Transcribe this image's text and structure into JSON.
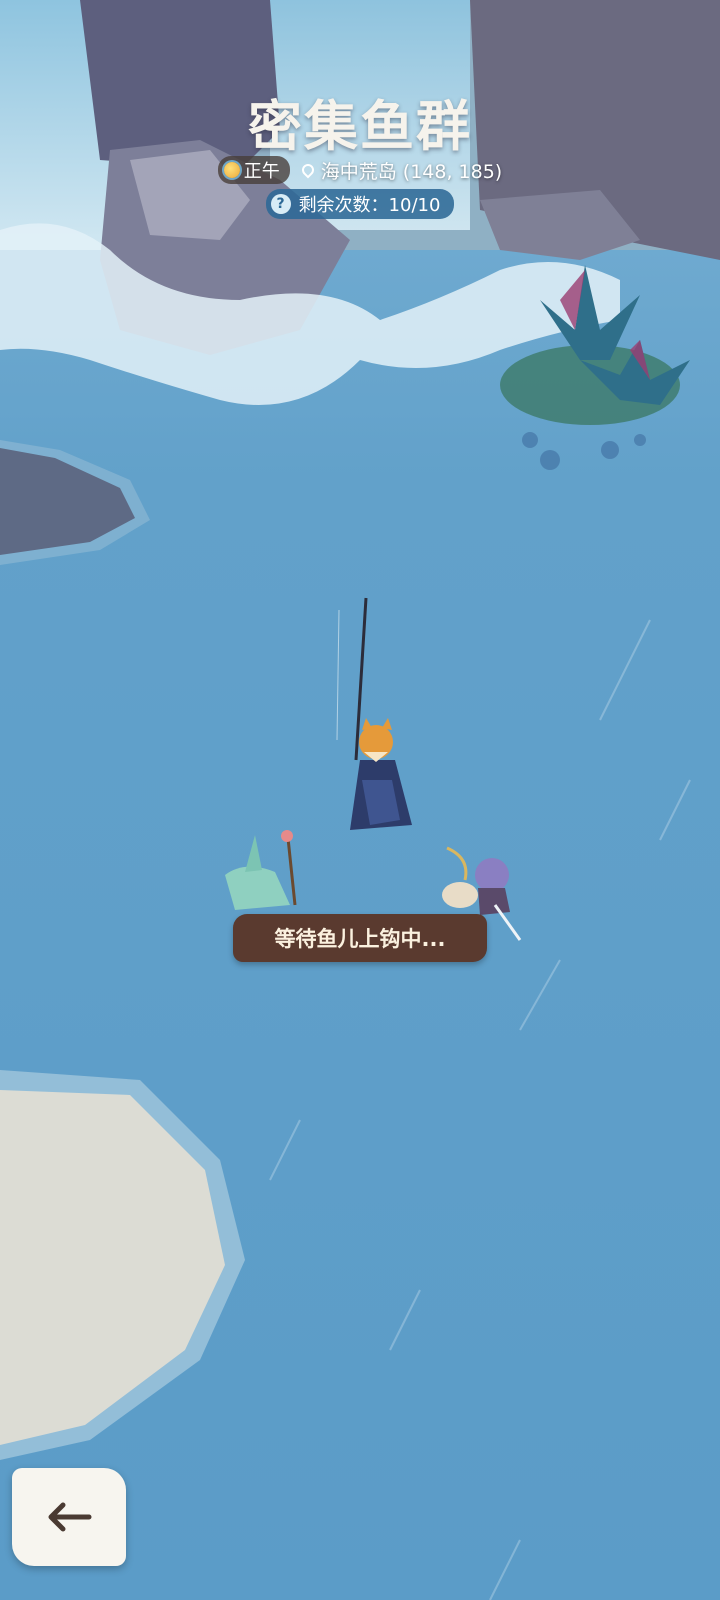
{
  "hud": {
    "title": "密集鱼群",
    "time_label": "正午",
    "location": "海中荒岛 (148, 185)",
    "remaining_label": "剩余次数：10/10",
    "time_icon": "sun-icon",
    "location_icon": "location-pin-icon",
    "remaining_icon": "fishing-hook-icon"
  },
  "status": {
    "message": "等待鱼儿上钩中..."
  },
  "controls": {
    "back_icon": "back-arrow-icon"
  },
  "colors": {
    "water": "#5f9fc9",
    "bubble": "#5a3a2f",
    "count_chip": "#2d6996"
  }
}
